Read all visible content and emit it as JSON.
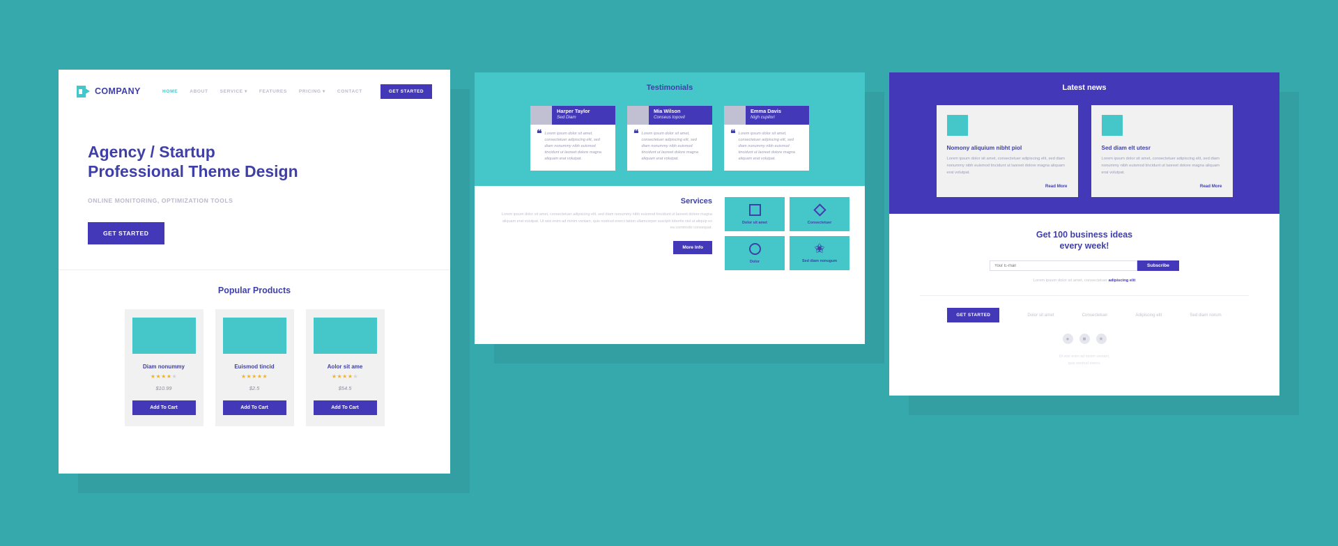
{
  "theme": {
    "background": "#36a9ad",
    "teal": "#45c6c9",
    "indigo": "#4339b8",
    "heading": "#3f3fa8",
    "muted": "#c2c2d0"
  },
  "home": {
    "logo": {
      "text": "COMPANY",
      "icon": "play-box-icon"
    },
    "nav": [
      {
        "label": "HOME",
        "active": true,
        "caret": false
      },
      {
        "label": "ABOUT",
        "active": false,
        "caret": false
      },
      {
        "label": "SERVICE",
        "active": false,
        "caret": true
      },
      {
        "label": "FEATURES",
        "active": false,
        "caret": false
      },
      {
        "label": "PRICING",
        "active": false,
        "caret": true
      },
      {
        "label": "CONTACT",
        "active": false,
        "caret": false
      }
    ],
    "nav_cta": "GET STARTED",
    "hero": {
      "line1": "Agency / Startup",
      "line2": "Professional Theme Design",
      "subtitle": "ONLINE MONITORING, OPTIMIZATION TOOLS",
      "cta": "GET STARTED"
    },
    "products_title": "Popular Products",
    "products": [
      {
        "name": "Diam nonummy",
        "rating": 4,
        "price": "$10.99",
        "button": "Add To Cart"
      },
      {
        "name": "Euismod tincid",
        "rating": 5,
        "price": "$2.5",
        "button": "Add To Cart"
      },
      {
        "name": "Aolor sit ame",
        "rating": 4,
        "price": "$54.5",
        "button": "Add To Cart"
      }
    ]
  },
  "testimonials": {
    "title": "Testimonials",
    "body": "Lorem ipsum dolor sit amet, consectetuer adipiscing elit, sed diam nonummy nibh euismod tincidunt ut laoreet dolore magna aliquam erat volutpat.",
    "items": [
      {
        "name": "Harper Taylor",
        "role": "Sed Diam"
      },
      {
        "name": "Mia Wilson",
        "role": "Conseus topovil"
      },
      {
        "name": "Emma Davis",
        "role": "Nigh cupilori"
      }
    ]
  },
  "services": {
    "title": "Services",
    "text": "Lorem ipsum dolor sit amet, consectetuer adipiscing elit, sed diam nonummy nibh euismod tincidunt ut laoreet dolore magna aliquam erat volutpat. Ut wisi enim ad minim veniam, quis nostrud exerci tation ullamcorper suscipit lobortis nisl ut aliquip ex ea commodo consequat.",
    "button": "More Info",
    "tiles": [
      {
        "label": "Dolor sit amet",
        "icon": "square-icon"
      },
      {
        "label": "Consectetuer",
        "icon": "diamond-icon"
      },
      {
        "label": "Dolor",
        "icon": "circle-icon"
      },
      {
        "label": "Sed diam nonugum",
        "icon": "star-icon"
      }
    ]
  },
  "news": {
    "title": "Latest news",
    "items": [
      {
        "title": "Nomony aliquium nibht piol",
        "text": "Lorem ipsum dolor sit amet, consectetuer adipiscing elit, sed diam nonummy nibh euismod tincidunt ut laoreet dolore magna aliquam erat volutpat.",
        "more": "Read More"
      },
      {
        "title": "Sed diam elt utesr",
        "text": "Lorem ipsum dolor sit amet, consectetuer adipiscing elit, sed diam nonummy nibh euismod tincidunt ut laoreet dolore magna aliquam erat volutpat.",
        "more": "Read More"
      }
    ]
  },
  "subscribe": {
    "title_line1": "Get 100 business ideas",
    "title_line2": "every week!",
    "placeholder": "Your E-mail",
    "value": "",
    "button": "Subscribe",
    "note_plain": "Lorem ipsum dolor sit amet, consectetuer ",
    "note_bold": "adipiscing elit"
  },
  "footer": {
    "cta": "GET STARTED",
    "links": [
      "Dolor sit amet",
      "Consectetuer",
      "Adipiscing elit",
      "Sed diam norum"
    ],
    "socials": [
      "circle-icon",
      "square-icon",
      "star-icon"
    ],
    "copyright_line1": "Ut wisi enim ad minim veniam,",
    "copyright_line2": "quis nostrud exerci."
  }
}
